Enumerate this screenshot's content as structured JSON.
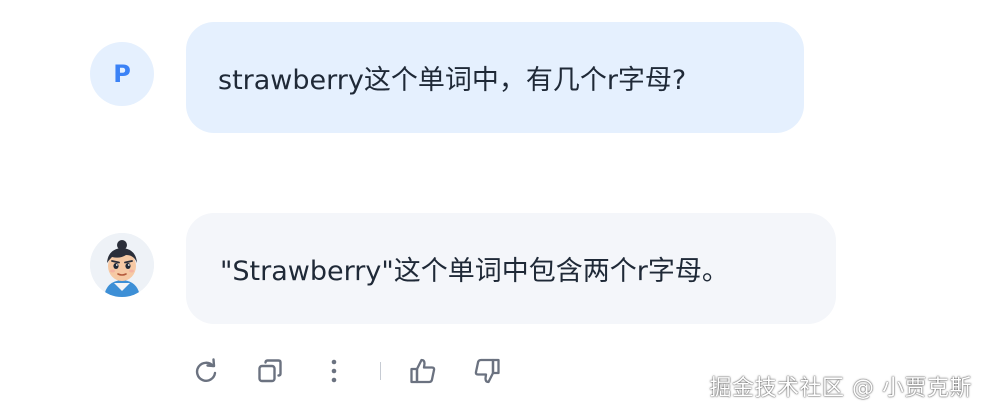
{
  "conversation": {
    "user": {
      "avatar_letter": "P",
      "message": "strawberry这个单词中，有几个r字母?"
    },
    "assistant": {
      "avatar_icon": "cartoon-character-avatar",
      "message": "\"Strawberry\"这个单词中包含两个r字母。"
    }
  },
  "actions": {
    "icons": [
      "refresh-icon",
      "copy-icon",
      "more-vertical-icon",
      "thumbs-up-icon",
      "thumbs-down-icon"
    ]
  },
  "watermark": {
    "text": "掘金技术社区 @ 小贾克斯"
  },
  "colors": {
    "user_bubble": "#e5f0fe",
    "bot_bubble": "#f4f6fa",
    "accent": "#3b82f6",
    "icon": "#6b7280"
  }
}
